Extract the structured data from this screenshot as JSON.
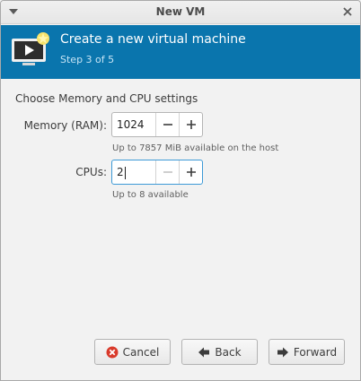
{
  "window": {
    "title": "New VM"
  },
  "banner": {
    "heading": "Create a new virtual machine",
    "step": "Step 3 of 5"
  },
  "section_title": "Choose Memory and CPU settings",
  "memory": {
    "label": "Memory (RAM):",
    "value": "1024",
    "hint": "Up to 7857 MiB available on the host",
    "decrement_enabled": true,
    "increment_enabled": true
  },
  "cpus": {
    "label": "CPUs:",
    "value": "2",
    "hint": "Up to 8 available",
    "decrement_enabled": false,
    "increment_enabled": true
  },
  "buttons": {
    "cancel": "Cancel",
    "back": "Back",
    "forward": "Forward"
  },
  "icons": {
    "window_menu": "chevron-down-icon",
    "window_close": "close-icon",
    "banner": "virtual-machine-new-icon",
    "cancel": "cancel-icon",
    "back": "arrow-left-icon",
    "forward": "arrow-right-icon",
    "minus": "minus-icon",
    "plus": "plus-icon"
  },
  "colors": {
    "banner_bg": "#0a75ad",
    "step_text": "#c6e4f5",
    "focus_border": "#3d9ad6",
    "cancel_red": "#d93a2b"
  }
}
